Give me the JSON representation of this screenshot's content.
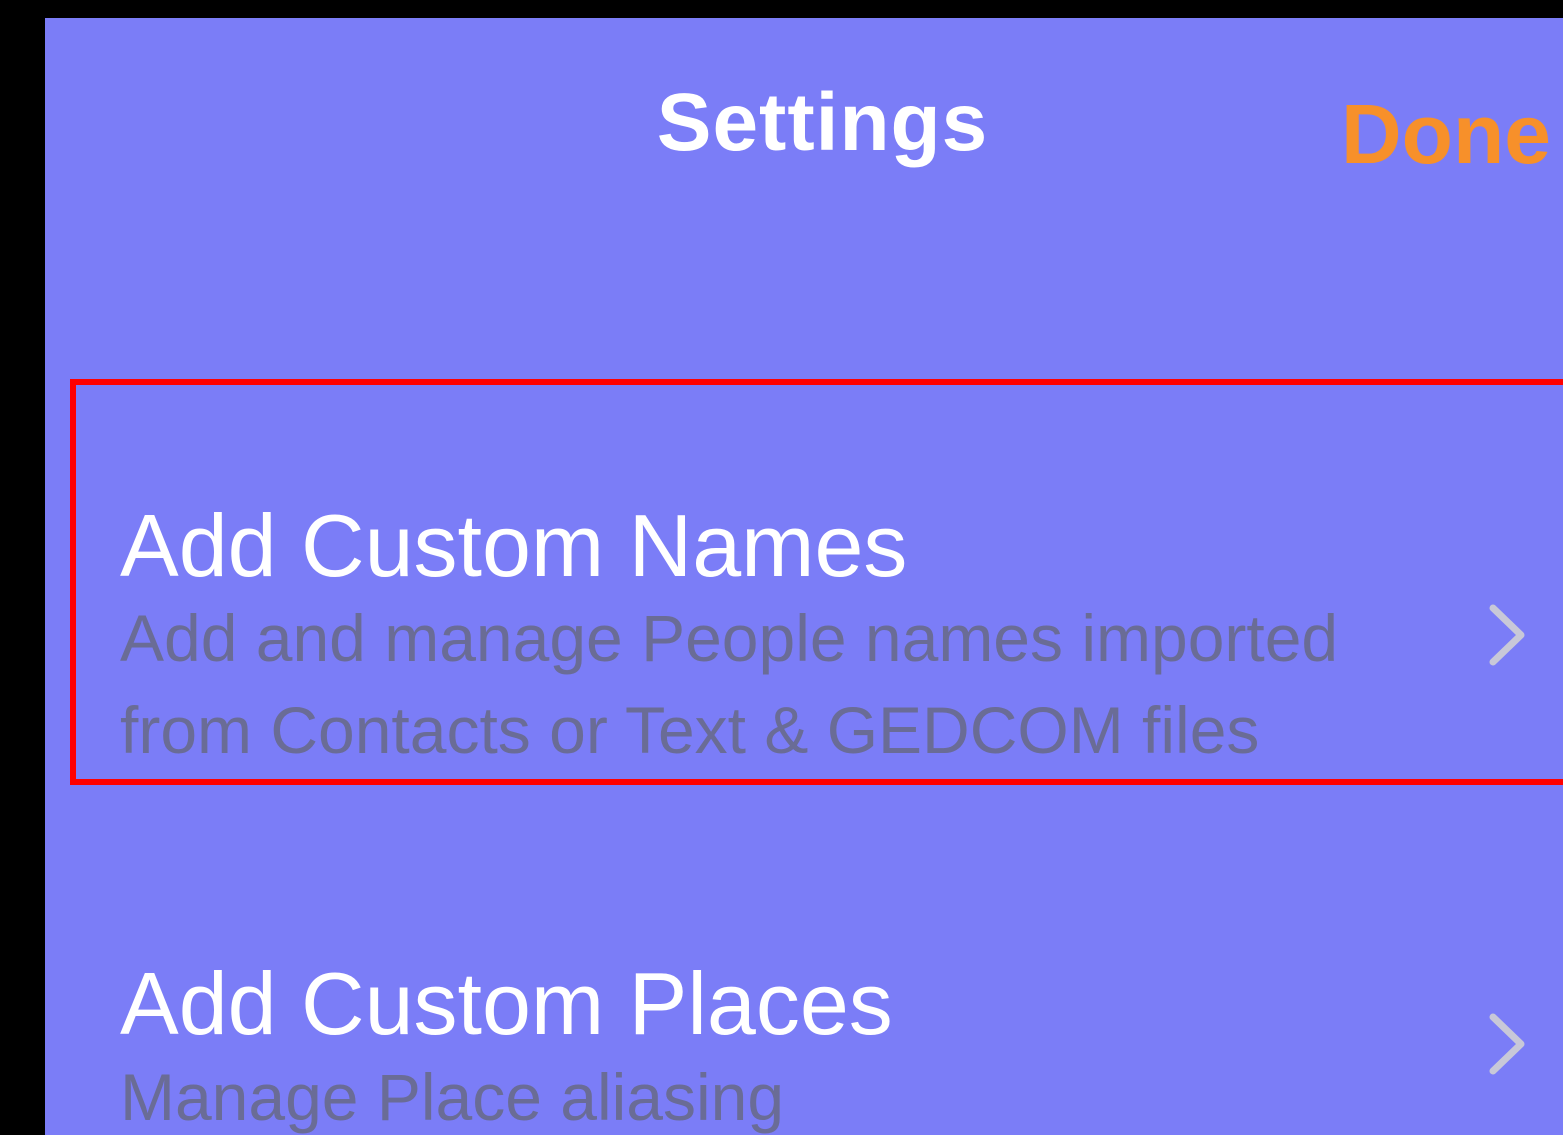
{
  "header": {
    "title": "Settings",
    "done_label": "Done"
  },
  "settings": {
    "items": [
      {
        "title": "Add Custom Names",
        "subtitle": "Add and manage People names imported from Contacts or Text & GEDCOM files",
        "highlighted": true
      },
      {
        "title": "Add Custom Places",
        "subtitle": "Manage Place aliasing",
        "highlighted": false
      }
    ]
  },
  "colors": {
    "background": "#7b7df7",
    "accent": "#f7902a",
    "title_text": "#ffffff",
    "subtitle_text": "#6a6c96",
    "highlight": "#ff0000"
  },
  "icons": {
    "disclosure": "chevron-right-icon"
  }
}
